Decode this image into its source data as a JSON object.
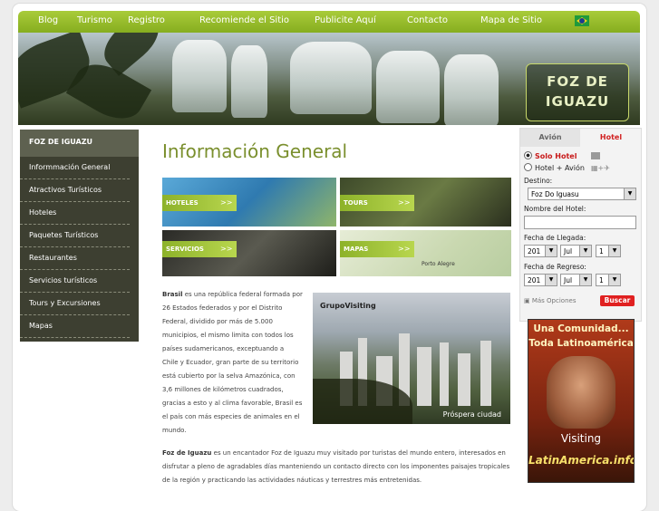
{
  "topnav": {
    "items": [
      "Blog",
      "Turismo",
      "Registro",
      "Recomiende el Sitio",
      "Publicite Aquí",
      "Contacto",
      "Mapa de Sitio"
    ]
  },
  "banner": {
    "logo_line1": "FOZ DE",
    "logo_line2": "IGUAZU"
  },
  "sidebar": {
    "title": "FOZ DE IGUAZU",
    "items": [
      "Informmación General",
      "Atractivos Turísticos",
      "Hoteles",
      "Paquetes Turísticos",
      "Restaurantes",
      "Servicios turísticos",
      "Tours y Excursiones",
      "Mapas"
    ]
  },
  "main": {
    "title": "Información General",
    "tiles": [
      "HOTELES",
      "TOURS",
      "SERVICIOS",
      "MAPAS"
    ],
    "tile_arrow": ">>",
    "map_place": "Porto Alegre",
    "photo_brand": "GrupoVisiting",
    "photo_caption": "Próspera ciudad",
    "p1_lines": [
      [
        "Brasil",
        " es una república federal formada por"
      ],
      [
        "",
        "26 Estados federados y por el Distrito"
      ],
      [
        "",
        "Federal, dividido por más de 5.000"
      ],
      [
        "",
        "municipios, el mismo limita con todos los"
      ],
      [
        "",
        "países sudamericanos, exceptuando a"
      ],
      [
        "",
        "Chile y Ecuador, gran parte de su territorio"
      ],
      [
        "",
        "está cubierto por la selva Amazónica, con"
      ],
      [
        "",
        "3,6 millones de kilómetros cuadrados,"
      ],
      [
        "",
        "gracias a esto y al clima favorable, Brasil es"
      ],
      [
        "",
        "el país con más especies de animales en el"
      ],
      [
        "",
        "mundo."
      ]
    ],
    "p2_lines": [
      [
        "Foz de Iguazu",
        " es un encantador Foz de Iguazu muy visitado por turistas del mundo entero, interesados en"
      ],
      [
        "",
        "disfrutar a pleno de agradables días manteniendo un contacto directo con los imponentes paisajes tropicales"
      ],
      [
        "",
        "de la región y practicando las actividades náuticas y terrestres más entretenidas."
      ]
    ]
  },
  "booking": {
    "tab_avion": "Avión",
    "tab_hotel": "Hotel",
    "opt_solo": "Solo Hotel",
    "opt_hotel_avion": "Hotel + Avión",
    "destino_label": "Destino:",
    "destino_value": "Foz Do Iguasu",
    "hotel_label": "Nombre del Hotel:",
    "llegada_label": "Fecha de Llegada:",
    "regreso_label": "Fecha de Regreso:",
    "year": "201",
    "month": "Jul",
    "day": "1",
    "more": "Más Opciones",
    "search": "Buscar",
    "colors": {
      "tab_active": "#d12020",
      "radio_active_text": "#c81a1a"
    }
  },
  "ad": {
    "line1": "Una Comunidad...",
    "line2": "Toda Latinoamérica",
    "line3": "Visiting",
    "line4": "LatinAmerica.info"
  },
  "colors": {
    "nav_green": "#95b82a",
    "sidebar_dark": "#3d3f31",
    "title_green": "#7a8f2d"
  }
}
